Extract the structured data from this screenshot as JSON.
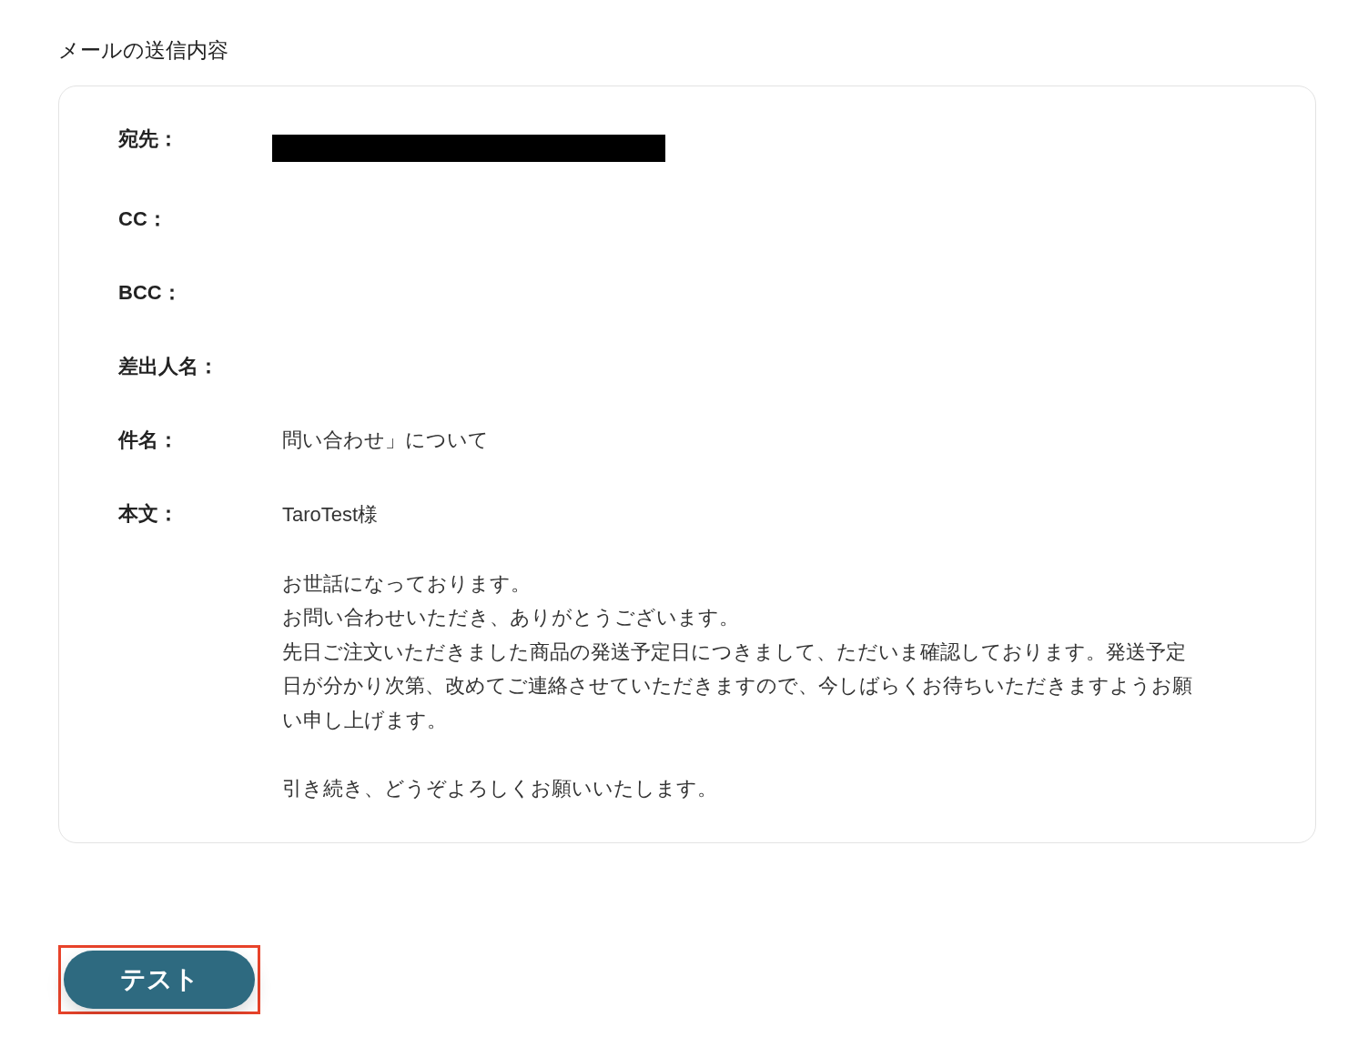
{
  "section_title": "メールの送信内容",
  "fields": [
    {
      "label": "宛先：",
      "kind": "redacted"
    },
    {
      "label": "CC：",
      "kind": "empty"
    },
    {
      "label": "BCC：",
      "kind": "empty"
    },
    {
      "label": "差出人名：",
      "kind": "empty"
    },
    {
      "label": "件名：",
      "kind": "text",
      "value": "問い合わせ」について"
    },
    {
      "label": "本文：",
      "kind": "body",
      "paragraphs": [
        [
          "TaroTest様"
        ],
        [
          "お世話になっております。",
          "お問い合わせいただき、ありがとうございます。",
          "先日ご注文いただきました商品の発送予定日につきまして、ただいま確認しております。発送予定",
          "日が分かり次第、改めてご連絡させていただきますので、今しばらくお待ちいただきますようお願",
          "い申し上げます。"
        ],
        [
          "引き続き、どうぞよろしくお願いいたします。"
        ]
      ]
    }
  ],
  "test_button": {
    "label": "テスト",
    "highlighted": true
  }
}
